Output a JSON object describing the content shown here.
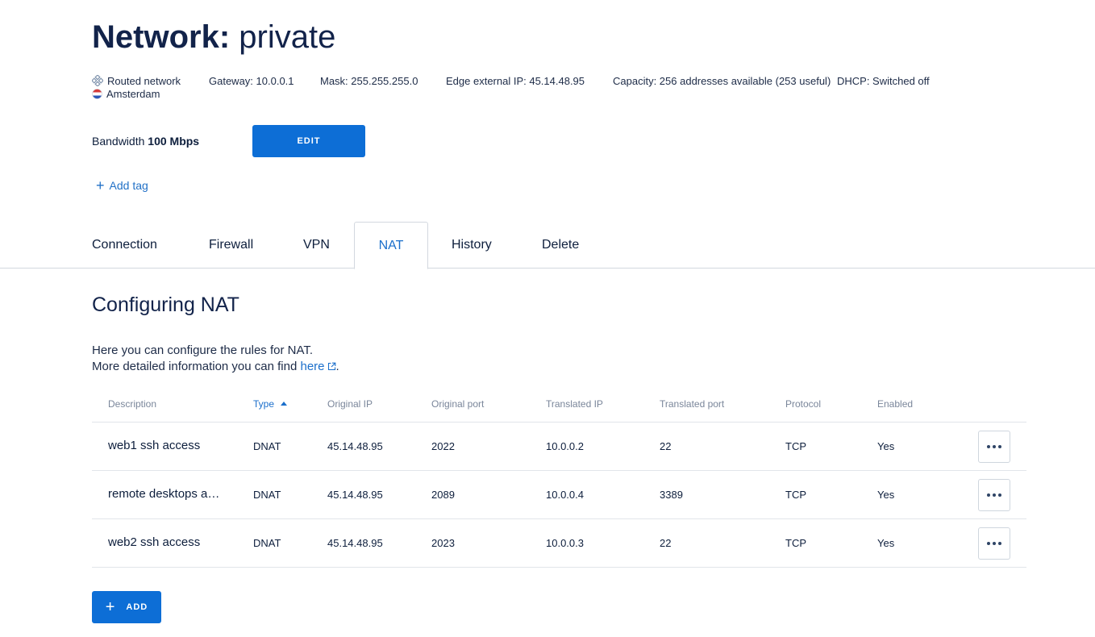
{
  "header": {
    "title_key": "Network:",
    "title_value": "private"
  },
  "meta": {
    "network_type": "Routed network",
    "location": "Amsterdam",
    "gateway": "Gateway: 10.0.0.1",
    "mask": "Mask: 255.255.255.0",
    "edge_ip": "Edge external IP: 45.14.48.95",
    "capacity": "Capacity: 256 addresses available (253 useful)",
    "dhcp": "DHCP: Switched off"
  },
  "bandwidth": {
    "label": "Bandwidth",
    "value": "100 Mbps",
    "edit_label": "EDIT"
  },
  "add_tag_label": "Add tag",
  "tabs": [
    {
      "label": "Connection"
    },
    {
      "label": "Firewall"
    },
    {
      "label": "VPN"
    },
    {
      "label": "NAT"
    },
    {
      "label": "History"
    },
    {
      "label": "Delete"
    }
  ],
  "active_tab": "NAT",
  "section": {
    "title": "Configuring NAT",
    "line1": "Here you can configure the rules for NAT.",
    "line2_prefix": "More detailed information you can find",
    "link_text": "here",
    "line2_suffix": "."
  },
  "table": {
    "columns": [
      "Description",
      "Type",
      "Original IP",
      "Original port",
      "Translated IP",
      "Translated port",
      "Protocol",
      "Enabled"
    ],
    "sorted_column": "Type",
    "rows": [
      {
        "description": "web1 ssh access",
        "type": "DNAT",
        "original_ip": "45.14.48.95",
        "original_port": "2022",
        "translated_ip": "10.0.0.2",
        "translated_port": "22",
        "protocol": "TCP",
        "enabled": "Yes"
      },
      {
        "description": "remote desktops access",
        "type": "DNAT",
        "original_ip": "45.14.48.95",
        "original_port": "2089",
        "translated_ip": "10.0.0.4",
        "translated_port": "3389",
        "protocol": "TCP",
        "enabled": "Yes"
      },
      {
        "description": "web2 ssh access",
        "type": "DNAT",
        "original_ip": "45.14.48.95",
        "original_port": "2023",
        "translated_ip": "10.0.0.3",
        "translated_port": "22",
        "protocol": "TCP",
        "enabled": "Yes"
      }
    ]
  },
  "add_button_label": "ADD",
  "colors": {
    "primary": "#0d6ed6",
    "link": "#1b6fcb",
    "text": "#0d1e3c"
  }
}
